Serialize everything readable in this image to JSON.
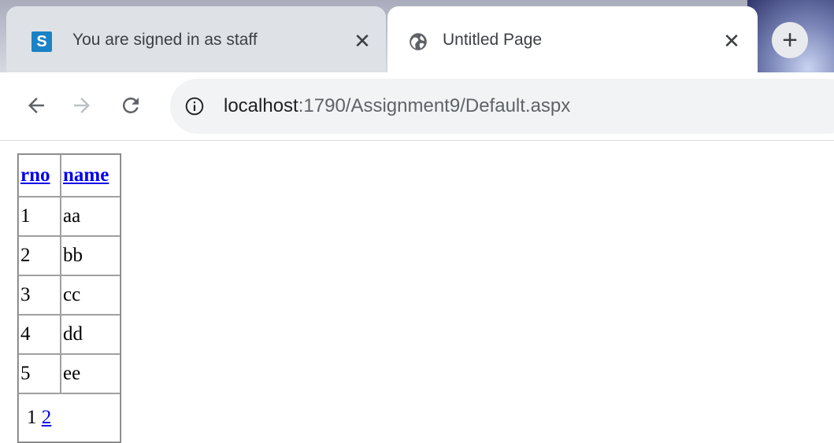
{
  "tabs": [
    {
      "title": "You are signed in as staff",
      "favicon": "S",
      "icon": "site-s-icon",
      "active": false
    },
    {
      "title": "Untitled Page",
      "icon": "globe-icon",
      "active": true
    }
  ],
  "new_tab_icon": "plus-icon",
  "toolbar": {
    "back_icon": "arrow-left-icon",
    "forward_icon": "arrow-right-icon",
    "reload_icon": "reload-icon"
  },
  "address": {
    "icon": "info-icon",
    "host": "localhost",
    "rest": ":1790/Assignment9/Default.aspx"
  },
  "grid": {
    "headers": [
      "rno",
      "name"
    ],
    "rows": [
      [
        "1",
        "aa"
      ],
      [
        "2",
        "bb"
      ],
      [
        "3",
        "cc"
      ],
      [
        "4",
        "dd"
      ],
      [
        "5",
        "ee"
      ]
    ],
    "pager": {
      "current": "1",
      "link": "2"
    }
  },
  "colors": {
    "link": "#0000ee",
    "tab_active": "#ffffff",
    "tab_inactive": "#dee1e6",
    "omnibox": "#f1f3f4",
    "favicon_bg": "#1a82c5"
  }
}
